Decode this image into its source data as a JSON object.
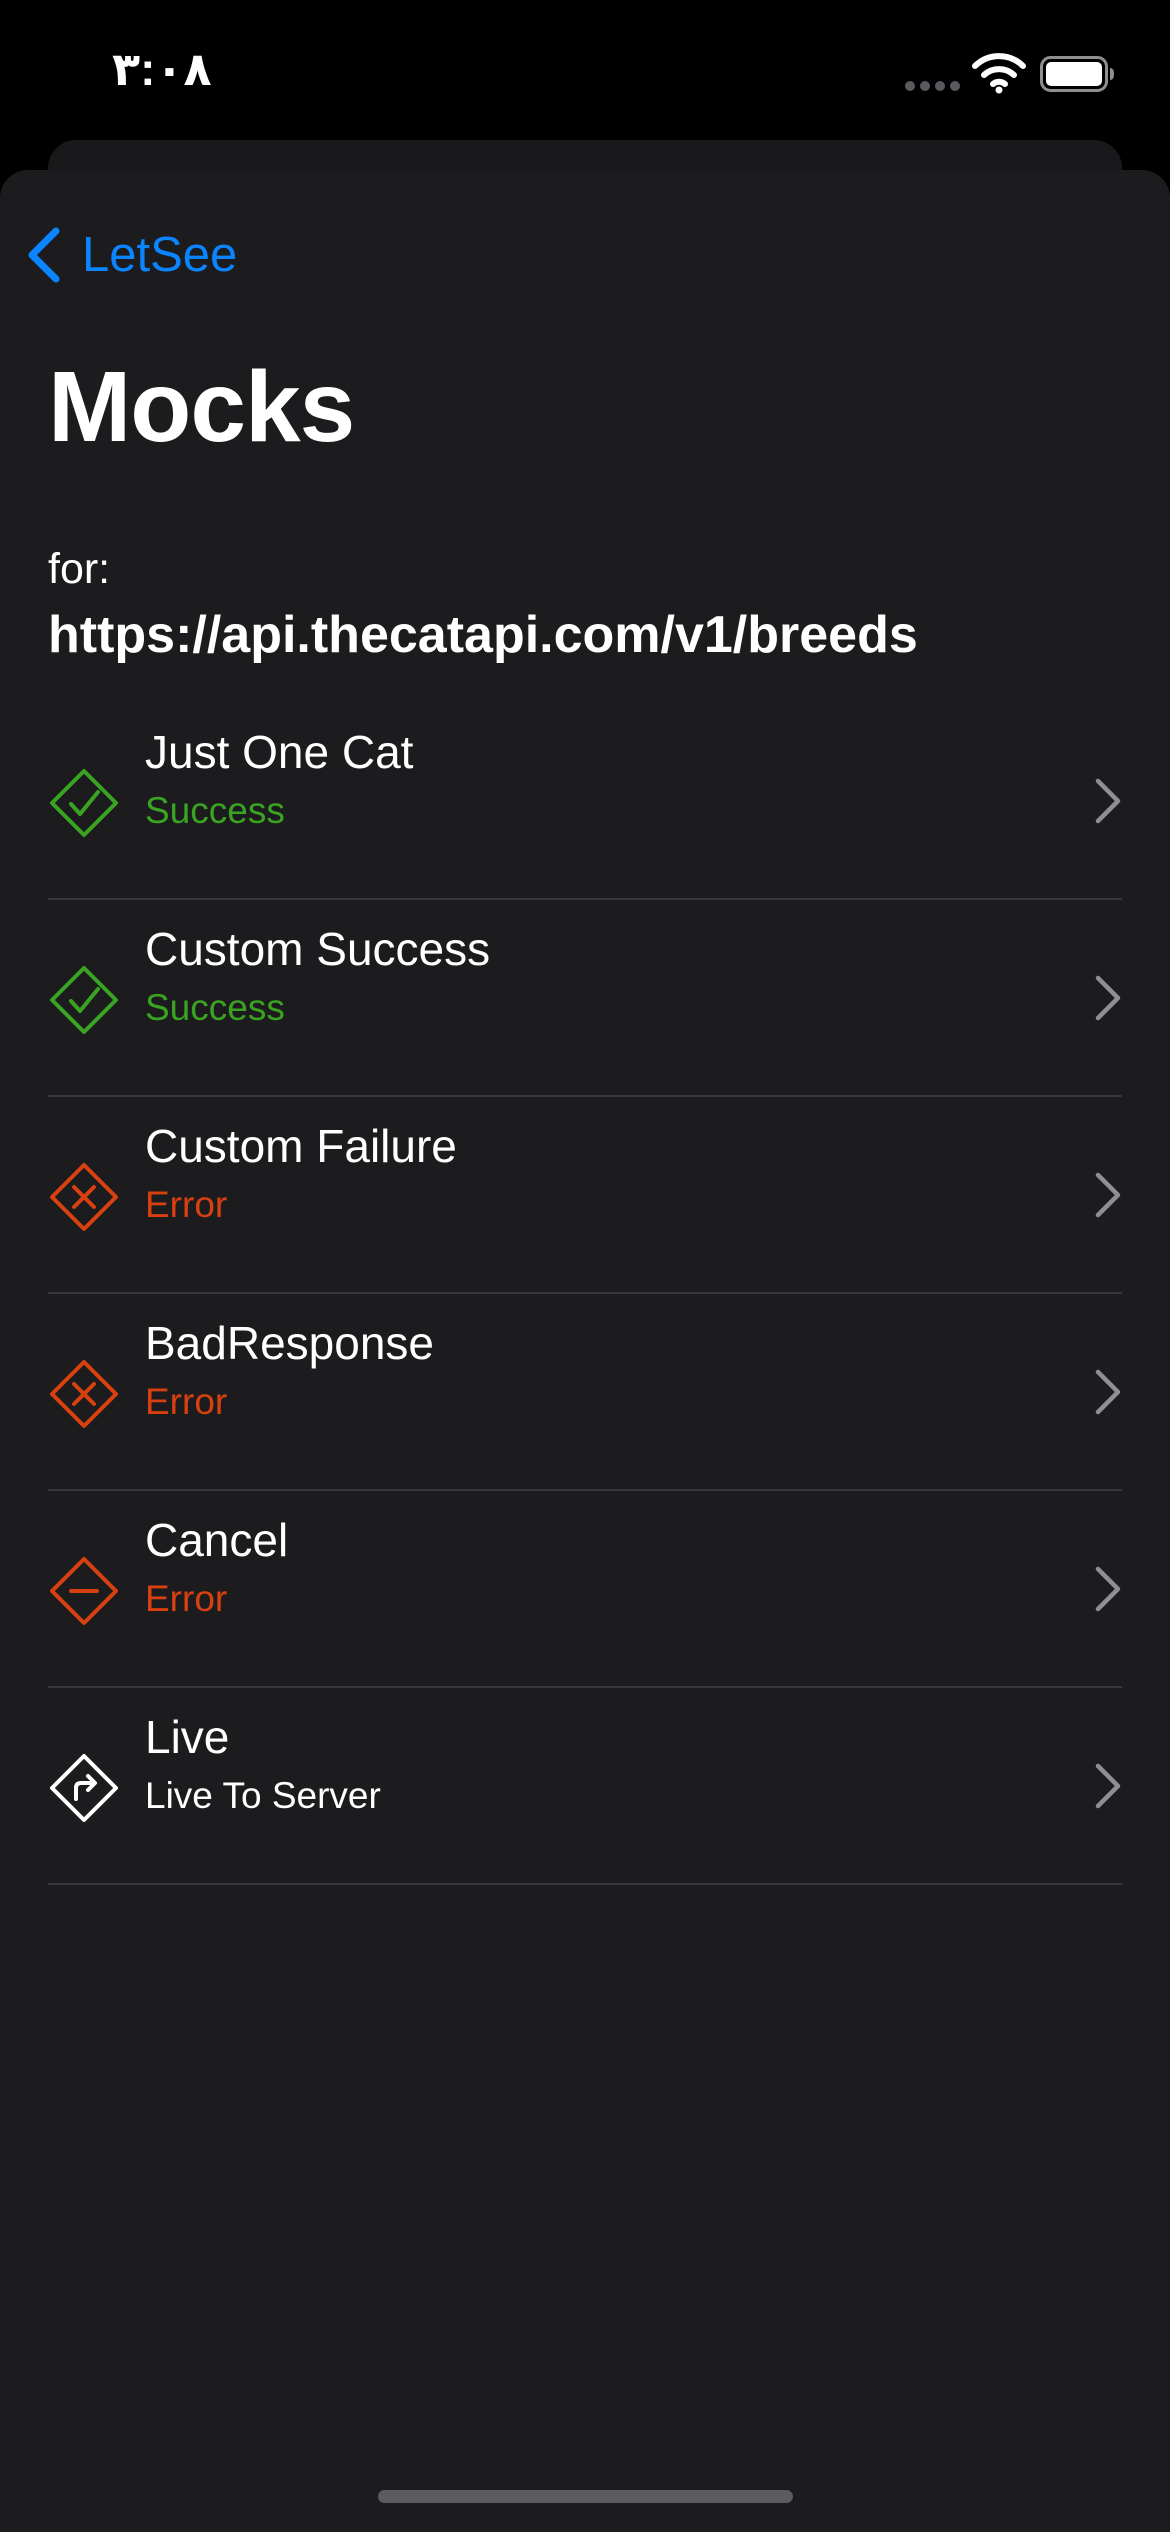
{
  "status_bar": {
    "time": "۳:۰۸",
    "wifi_icon": "wifi-icon",
    "battery_icon": "battery-full-icon"
  },
  "nav": {
    "back_label": "LetSee",
    "back_icon": "chevron-left-icon"
  },
  "header": {
    "title": "Mocks",
    "for_label": "for:",
    "url": "https://api.thecatapi.com/v1/breeds"
  },
  "colors": {
    "accent": "#0a84ff",
    "success": "#3aa321",
    "error": "#d8400f",
    "live": "#ffffff",
    "background": "#1c1c1e",
    "separator": "#38383a"
  },
  "mocks": [
    {
      "title": "Just One Cat",
      "subtitle": "Success",
      "status": "success",
      "icon": "checkmark-diamond-icon"
    },
    {
      "title": "Custom Success",
      "subtitle": "Success",
      "status": "success",
      "icon": "checkmark-diamond-icon"
    },
    {
      "title": "Custom Failure",
      "subtitle": "Error",
      "status": "error",
      "icon": "xmark-diamond-icon"
    },
    {
      "title": "BadResponse",
      "subtitle": "Error",
      "status": "error",
      "icon": "xmark-diamond-icon"
    },
    {
      "title": "Cancel",
      "subtitle": "Error",
      "status": "error",
      "icon": "minus-diamond-icon"
    },
    {
      "title": "Live",
      "subtitle": "Live To Server",
      "status": "live",
      "icon": "arrow-turn-right-diamond-icon"
    }
  ]
}
